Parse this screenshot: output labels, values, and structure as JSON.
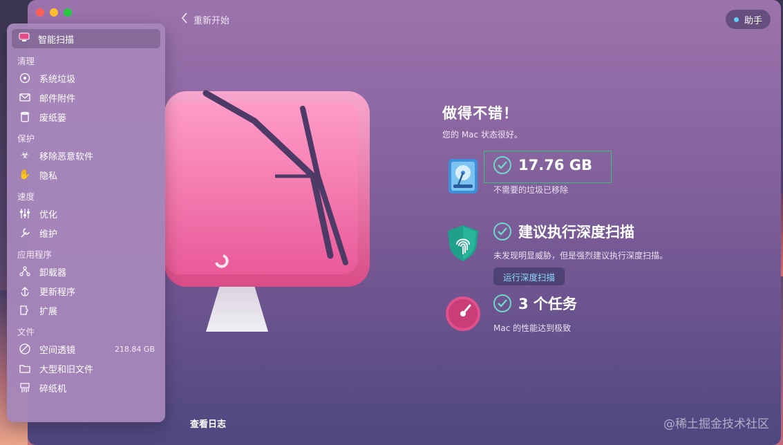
{
  "header": {
    "restart_label": "重新开始",
    "assistant_label": "助手"
  },
  "sidebar": {
    "active": {
      "label": "智能扫描",
      "icon": "monitor-icon"
    },
    "sections": [
      {
        "title": "清理",
        "items": [
          {
            "label": "系统垃圾",
            "icon": "disk-icon"
          },
          {
            "label": "邮件附件",
            "icon": "mail-icon"
          },
          {
            "label": "废纸篓",
            "icon": "trash-icon"
          }
        ]
      },
      {
        "title": "保护",
        "items": [
          {
            "label": "移除恶意软件",
            "icon": "biohazard-icon"
          },
          {
            "label": "隐私",
            "icon": "hand-icon"
          }
        ]
      },
      {
        "title": "速度",
        "items": [
          {
            "label": "优化",
            "icon": "sliders-icon"
          },
          {
            "label": "维护",
            "icon": "wrench-icon"
          }
        ]
      },
      {
        "title": "应用程序",
        "items": [
          {
            "label": "卸载器",
            "icon": "uninstaller-icon"
          },
          {
            "label": "更新程序",
            "icon": "update-icon"
          },
          {
            "label": "扩展",
            "icon": "extension-icon"
          }
        ]
      },
      {
        "title": "文件",
        "items": [
          {
            "label": "空间透镜",
            "icon": "lens-icon",
            "size": "218.84 GB"
          },
          {
            "label": "大型和旧文件",
            "icon": "folder-icon"
          },
          {
            "label": "碎纸机",
            "icon": "shredder-icon"
          }
        ]
      }
    ]
  },
  "result": {
    "headline": "做得不错！",
    "subhead": "您的 Mac 状态很好。",
    "cleanup": {
      "title": "17.76 GB",
      "desc": "不需要的垃圾已移除"
    },
    "protection": {
      "title": "建议执行深度扫描",
      "desc": "未发现明显威胁，但是强烈建议执行深度扫描。",
      "button": "运行深度扫描"
    },
    "speed": {
      "title": "3 个任务",
      "desc": "Mac 的性能达到极致"
    }
  },
  "footer": {
    "log_label": "查看日志",
    "watermark": "@稀土掘金技术社区"
  },
  "colors": {
    "accent_check": "#6fd8c8",
    "button_text": "#8fd8ff"
  }
}
